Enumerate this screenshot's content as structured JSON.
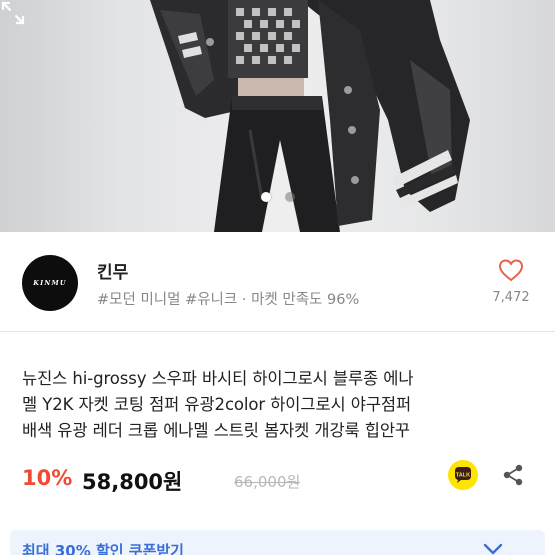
{
  "gallery": {
    "slide_count": 2,
    "active_index": 0,
    "expand_icon": "expand-arrows-icon"
  },
  "seller": {
    "logo_text": "KINMU",
    "name": "킨무",
    "tags": "#모던 미니멀 #유니크",
    "separator": " · ",
    "satisfaction": "마켓 만족도 96%",
    "like_icon": "heart-outline-icon",
    "like_count": "7,472"
  },
  "product": {
    "title_lines": [
      "뉴진스 hi-grossy 스우파 바시티 하이그로시 블루종 에나",
      "멜 Y2K 자켓 코팅 점퍼 유광2color 하이그로시 야구점퍼",
      "배색 유광 레더 크롭 에나멜 스트릿 봄자켓 개강룩 힙안꾸"
    ],
    "discount": "10%",
    "price": "58,800원",
    "original_price": "66,000원",
    "talk_label": "TALK",
    "share_icon": "share-icon"
  },
  "coupon": {
    "label": "최대 30% 할인 쿠폰받기",
    "chevron_icon": "chevron-down-icon"
  },
  "colors": {
    "discount": "#f04a37",
    "coupon_text": "#3a6fd8",
    "coupon_bg": "#eef4fd",
    "talk_yellow": "#fee500"
  }
}
